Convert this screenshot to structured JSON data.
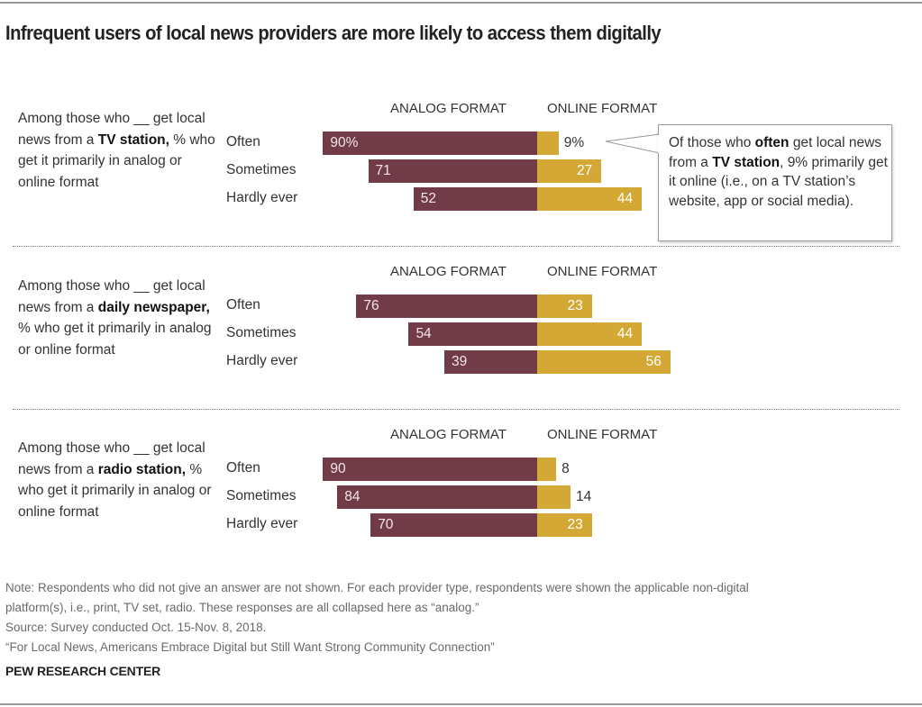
{
  "title": "Infrequent users of local news providers are more likely to access them digitally",
  "chart_data": [
    {
      "type": "bar",
      "orientation": "horizontal-diverging",
      "provider": "TV station",
      "description_parts": [
        "Among those who __ get local news from a ",
        "TV station,",
        " % who get it primarily in analog or online format"
      ],
      "column_headers": [
        "ANALOG FORMAT",
        "ONLINE FORMAT"
      ],
      "categories": [
        "Often",
        "Sometimes",
        "Hardly ever"
      ],
      "series": [
        {
          "name": "Analog format",
          "color": "#713c47",
          "values": [
            90,
            71,
            52
          ],
          "labels": [
            "90%",
            "71",
            "52"
          ]
        },
        {
          "name": "Online format",
          "color": "#d4a834",
          "values": [
            9,
            27,
            44
          ],
          "labels": [
            "9%",
            "27",
            "44"
          ]
        }
      ],
      "annotation": {
        "parts": [
          "Of those who ",
          "often",
          " get local news from a ",
          "TV station",
          ", 9% primarily get it online (i.e., on a TV station’s website, app or social media)."
        ]
      }
    },
    {
      "type": "bar",
      "orientation": "horizontal-diverging",
      "provider": "daily newspaper",
      "description_parts": [
        "Among those who __ get local news from a ",
        "daily newspaper,",
        " % who get it primarily in analog or online format"
      ],
      "column_headers": [
        "ANALOG FORMAT",
        "ONLINE FORMAT"
      ],
      "categories": [
        "Often",
        "Sometimes",
        "Hardly ever"
      ],
      "series": [
        {
          "name": "Analog format",
          "color": "#713c47",
          "values": [
            76,
            54,
            39
          ],
          "labels": [
            "76",
            "54",
            "39"
          ]
        },
        {
          "name": "Online format",
          "color": "#d4a834",
          "values": [
            23,
            44,
            56
          ],
          "labels": [
            "23",
            "44",
            "56"
          ]
        }
      ]
    },
    {
      "type": "bar",
      "orientation": "horizontal-diverging",
      "provider": "radio station",
      "description_parts": [
        "Among those who __ get local news from a ",
        "radio station,",
        " % who get it primarily in analog or online format"
      ],
      "column_headers": [
        "ANALOG FORMAT",
        "ONLINE FORMAT"
      ],
      "categories": [
        "Often",
        "Sometimes",
        "Hardly ever"
      ],
      "series": [
        {
          "name": "Analog format",
          "color": "#713c47",
          "values": [
            90,
            84,
            70
          ],
          "labels": [
            "90",
            "84",
            "70"
          ]
        },
        {
          "name": "Online format",
          "color": "#d4a834",
          "values": [
            8,
            14,
            23
          ],
          "labels": [
            "8",
            "14",
            "23"
          ]
        }
      ]
    }
  ],
  "notes": [
    "Note: Respondents who did not give an answer are not shown. For each provider type, respondents were shown the applicable non-digital",
    "platform(s), i.e., print, TV set, radio. These responses are all collapsed here as “analog.”",
    "Source: Survey conducted Oct. 15-Nov. 8, 2018.",
    "“For Local News, Americans Embrace Digital but Still Want Strong Community Connection”"
  ],
  "brand": "PEW RESEARCH CENTER"
}
